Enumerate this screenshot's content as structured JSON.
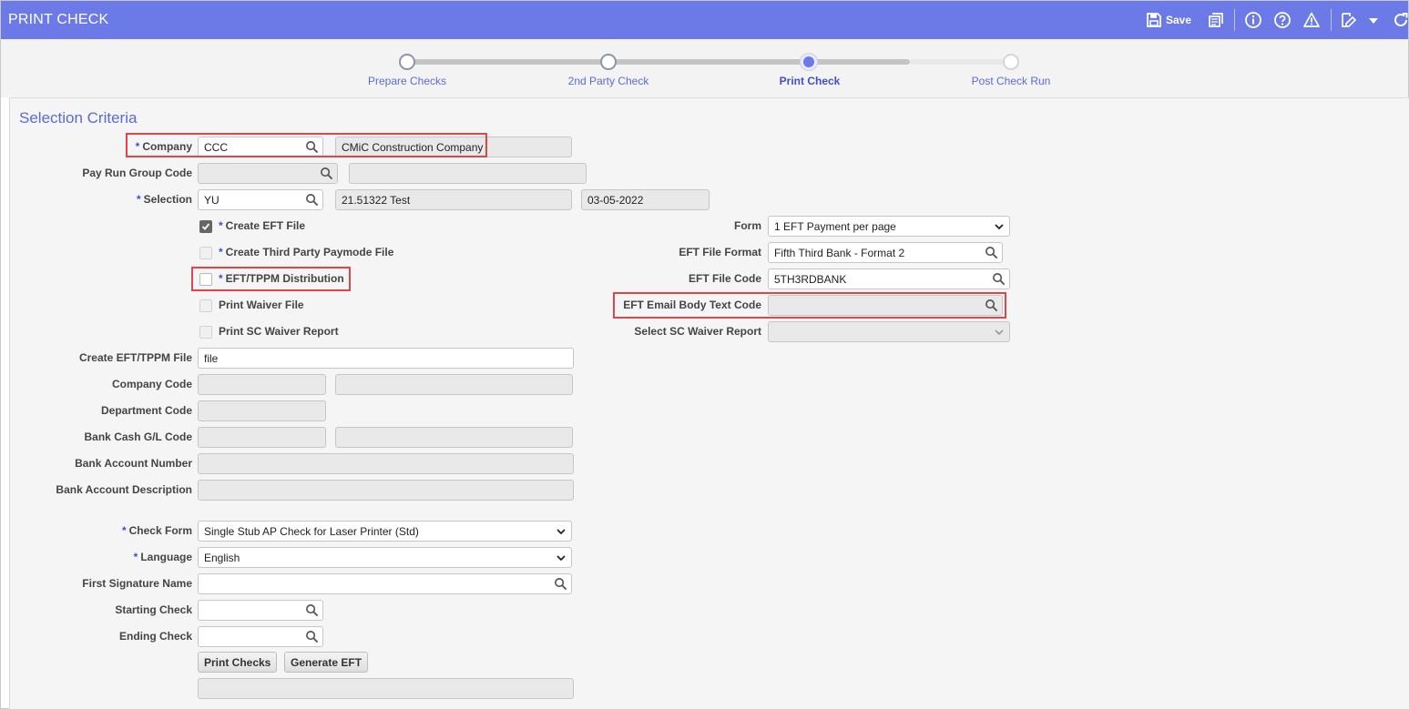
{
  "app": {
    "title": "PRINT CHECK"
  },
  "toolbar": {
    "save_label": "Save",
    "icons": [
      "save-icon",
      "report-icon",
      "info-icon",
      "help-icon",
      "warning-icon",
      "edit-icon",
      "dropdown-caret-icon",
      "refresh-icon"
    ]
  },
  "wizard": {
    "steps": [
      {
        "label": "Prepare Checks",
        "state": "done"
      },
      {
        "label": "2nd Party Check",
        "state": "done"
      },
      {
        "label": "Print Check",
        "state": "active"
      },
      {
        "label": "Post Check Run",
        "state": "todo"
      }
    ]
  },
  "section": {
    "title": "Selection Criteria"
  },
  "form": {
    "company": {
      "req": "*",
      "label": "Company",
      "value": "CCC",
      "description": "CMiC Construction Company"
    },
    "pay_run_group": {
      "label": "Pay Run Group Code",
      "value": "",
      "description": ""
    },
    "selection": {
      "req": "*",
      "label": "Selection",
      "value": "YU",
      "description": "21.51322 Test",
      "date": "03-05-2022"
    },
    "create_eft_file": {
      "req": "*",
      "label": "Create EFT File",
      "checked": true
    },
    "create_third_party": {
      "req": "*",
      "label": "Create Third Party Paymode File",
      "checked": false
    },
    "eft_tppm_distribution": {
      "req": "*",
      "label": "EFT/TPPM Distribution",
      "checked": false
    },
    "print_waiver_file": {
      "label": "Print Waiver File",
      "checked": false
    },
    "print_sc_waiver_report": {
      "label": "Print SC Waiver Report",
      "checked": false
    },
    "form": {
      "label": "Form",
      "value": "1 EFT Payment per page"
    },
    "eft_file_format": {
      "label": "EFT File Format",
      "value": "Fifth Third Bank - Format 2"
    },
    "eft_file_code": {
      "label": "EFT File Code",
      "value": "5TH3RDBANK"
    },
    "eft_email_body": {
      "label": "EFT Email Body Text Code",
      "value": ""
    },
    "select_sc_waiver": {
      "label": "Select SC Waiver Report",
      "value": ""
    },
    "create_eft_tppm_file": {
      "label": "Create EFT/TPPM File",
      "value": "file"
    },
    "company_code": {
      "label": "Company Code",
      "value": "",
      "description": ""
    },
    "department_code": {
      "label": "Department Code",
      "value": ""
    },
    "bank_cash_gl": {
      "label": "Bank Cash G/L Code",
      "value": "",
      "description": ""
    },
    "bank_account_number": {
      "label": "Bank Account Number",
      "value": ""
    },
    "bank_account_description": {
      "label": "Bank Account Description",
      "value": ""
    },
    "check_form": {
      "req": "*",
      "label": "Check Form",
      "value": "Single Stub AP Check for Laser Printer (Std)"
    },
    "language": {
      "req": "*",
      "label": "Language",
      "value": "English"
    },
    "first_signature": {
      "label": "First Signature Name",
      "value": ""
    },
    "starting_check": {
      "label": "Starting Check",
      "value": ""
    },
    "ending_check": {
      "label": "Ending Check",
      "value": ""
    }
  },
  "buttons": {
    "print_checks": "Print Checks",
    "generate_eft": "Generate EFT"
  },
  "status_field": {
    "value": ""
  },
  "colors": {
    "header": "#6c7ae8",
    "accent": "#5b6bd6",
    "highlight": "#e0454a"
  }
}
